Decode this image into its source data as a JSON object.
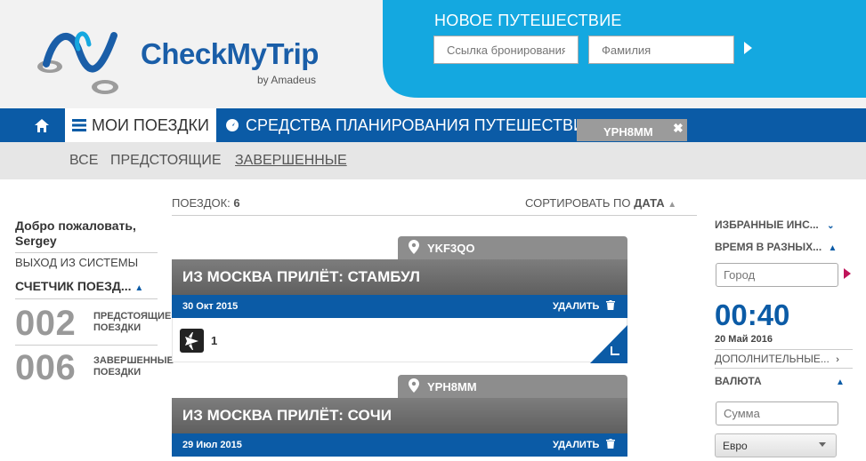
{
  "header": {
    "brand": "CheckMyTrip",
    "brand_sub": "by Amadeus",
    "new_trip_title": "НОВОЕ ПУТЕШЕСТВИЕ",
    "booking_placeholder": "Ссылка бронирования",
    "surname_placeholder": "Фамилия"
  },
  "nav": {
    "my_trips": "МОИ ПОЕЗДКИ",
    "planning": "СРЕДСТВА ПЛАНИРОВАНИЯ ПУТЕШЕСТВИЙ",
    "tooltip_code": "YPH8MM",
    "tooltip_close": "✖"
  },
  "subnav": {
    "all": "ВСЕ",
    "upcoming": "ПРЕДСТОЯЩИЕ",
    "completed": "ЗАВЕРШЕННЫЕ"
  },
  "left": {
    "welcome": "Добро пожаловать,",
    "user": "Sergey",
    "logout": "ВЫХОД ИЗ СИСТЕМЫ",
    "counter_title": "СЧЕТЧИК ПОЕЗД...",
    "upcoming_count": "002",
    "upcoming_label_1": "ПРЕДСТОЯЩИЕ",
    "upcoming_label_2": "ПОЕЗДКИ",
    "completed_count": "006",
    "completed_label_1": "ЗАВЕРШЕННЫЕ",
    "completed_label_2": "ПОЕЗДКИ"
  },
  "center": {
    "trips_label": "ПОЕЗДОК:",
    "trips_count": "6",
    "sort_label": "СОРТИРОВАТЬ ПО",
    "sort_field": "ДАТА",
    "trips": [
      {
        "code": "YKF3QO",
        "title": "ИЗ МОСКВА ПРИЛЁТ: СТАМБУЛ",
        "date": "30 Окт 2015",
        "delete": "УДАЛИТЬ",
        "flights": "1"
      },
      {
        "code": "YPH8MM",
        "title": "ИЗ МОСКВА ПРИЛЁТ: СОЧИ",
        "date": "29 Июл 2015",
        "delete": "УДАЛИТЬ"
      }
    ]
  },
  "right": {
    "favorites": "ИЗБРАННЫЕ ИНС...",
    "time_zones": "ВРЕМЯ В РАЗНЫХ...",
    "city_placeholder": "Город",
    "clock": "00:40",
    "clock_date": "20 Май 2016",
    "additional": "ДОПОЛНИТЕЛЬНЫЕ...",
    "currency_title": "ВАЛЮТА",
    "amount_placeholder": "Сумма",
    "currency_value": "Евро"
  },
  "colors": {
    "brand_blue": "#1a5ea8",
    "nav_blue": "#0b5ba6",
    "header_cyan": "#14a8e0",
    "card_grey": "#6e6e6e"
  }
}
